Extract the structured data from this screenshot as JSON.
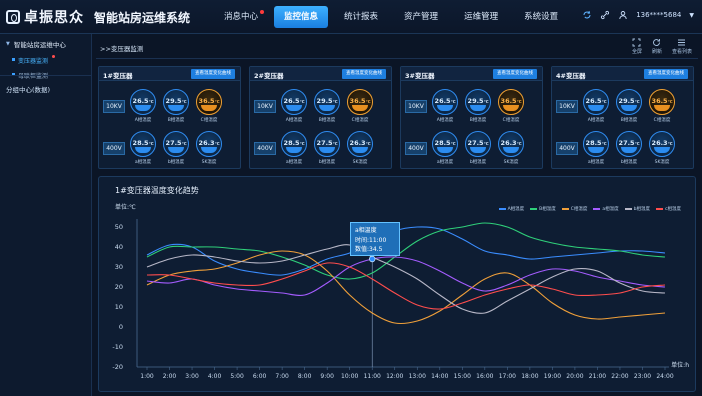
{
  "header": {
    "brand": "卓振思众",
    "app_title": "智能站房运维系统",
    "nav": [
      {
        "label": "消息中心",
        "active": false,
        "dot": true
      },
      {
        "label": "监控信息",
        "active": true,
        "dot": false
      },
      {
        "label": "统计报表",
        "active": false,
        "dot": false
      },
      {
        "label": "资产管理",
        "active": false,
        "dot": false
      },
      {
        "label": "运维管理",
        "active": false,
        "dot": false
      },
      {
        "label": "系统设置",
        "active": false,
        "dot": false
      }
    ],
    "user": "136****5684"
  },
  "sidebar": {
    "group1": "智能站房运维中心",
    "items": [
      {
        "label": "变压器监测",
        "active": true
      },
      {
        "label": "母联柜监测",
        "active": false
      }
    ],
    "group2": "分组中心(数据)"
  },
  "main": {
    "breadcrumb": ">>变压器监测",
    "tools": [
      "全屏",
      "刷新",
      "查看列表"
    ]
  },
  "cards": [
    {
      "title": "1#变压器",
      "button": "查看温度变化曲线",
      "row1": {
        "volt": "10KV",
        "gauges": [
          {
            "v": "26.5",
            "l": "A相温度"
          },
          {
            "v": "29.5",
            "l": "B相温度"
          },
          {
            "v": "36.5",
            "l": "C相温度",
            "warn": true
          }
        ]
      },
      "row2": {
        "volt": "400V",
        "gauges": [
          {
            "v": "28.5",
            "l": "a相温度"
          },
          {
            "v": "27.5",
            "l": "b相温度"
          },
          {
            "v": "26.3",
            "l": "SK温度"
          }
        ]
      }
    },
    {
      "title": "2#变压器",
      "button": "查看温度变化曲线",
      "row1": {
        "volt": "10KV",
        "gauges": [
          {
            "v": "26.5",
            "l": "A相温度"
          },
          {
            "v": "29.5",
            "l": "B相温度"
          },
          {
            "v": "36.5",
            "l": "C相温度",
            "warn": true
          }
        ]
      },
      "row2": {
        "volt": "400V",
        "gauges": [
          {
            "v": "28.5",
            "l": "a相温度"
          },
          {
            "v": "27.5",
            "l": "b相温度"
          },
          {
            "v": "26.3",
            "l": "SK温度"
          }
        ]
      }
    },
    {
      "title": "3#变压器",
      "button": "查看温度变化曲线",
      "row1": {
        "volt": "10KV",
        "gauges": [
          {
            "v": "26.5",
            "l": "A相温度"
          },
          {
            "v": "29.5",
            "l": "B相温度"
          },
          {
            "v": "36.5",
            "l": "C相温度",
            "warn": true
          }
        ]
      },
      "row2": {
        "volt": "400V",
        "gauges": [
          {
            "v": "28.5",
            "l": "a相温度"
          },
          {
            "v": "27.5",
            "l": "b相温度"
          },
          {
            "v": "26.3",
            "l": "SK温度"
          }
        ]
      }
    },
    {
      "title": "4#变压器",
      "button": "查看温度变化曲线",
      "row1": {
        "volt": "10KV",
        "gauges": [
          {
            "v": "26.5",
            "l": "A相温度"
          },
          {
            "v": "29.5",
            "l": "B相温度"
          },
          {
            "v": "36.5",
            "l": "C相温度",
            "warn": true
          }
        ]
      },
      "row2": {
        "volt": "400V",
        "gauges": [
          {
            "v": "28.5",
            "l": "a相温度"
          },
          {
            "v": "27.5",
            "l": "b相温度"
          },
          {
            "v": "26.3",
            "l": "SK温度"
          }
        ]
      }
    }
  ],
  "gauge_unit": "℃",
  "chart_data": {
    "type": "line",
    "title": "1#变压器温度变化趋势",
    "ylabel": "单位:℃",
    "xlabel": "单位:h",
    "ylim": [
      -20,
      50
    ],
    "yticks": [
      50,
      40,
      30,
      20,
      10,
      0,
      -10,
      -20
    ],
    "categories": [
      "1:00",
      "2:00",
      "3:00",
      "4:00",
      "5:00",
      "6:00",
      "7:00",
      "8:00",
      "9:00",
      "10:00",
      "11:00",
      "12:00",
      "13:00",
      "14:00",
      "15:00",
      "16:00",
      "17:00",
      "18:00",
      "19:00",
      "20:00",
      "21:00",
      "22:00",
      "23:00",
      "24:00"
    ],
    "legend_position": "top-right",
    "grid": false,
    "series": [
      {
        "name": "A相温度",
        "color": "#3a8dff",
        "values": [
          36,
          41,
          40,
          33,
          29,
          27,
          26,
          29,
          34,
          37,
          42,
          48,
          50,
          49,
          44,
          38,
          36,
          34,
          35,
          36,
          37,
          38,
          38,
          37
        ]
      },
      {
        "name": "B相温度",
        "color": "#2fd07a",
        "values": [
          35,
          40,
          40,
          40,
          39,
          38,
          35,
          31,
          26,
          24,
          27,
          35,
          43,
          48,
          50,
          52,
          50,
          45,
          42,
          40,
          39,
          38,
          36,
          35
        ]
      },
      {
        "name": "C相温度",
        "color": "#f0a03a",
        "values": [
          21,
          26,
          28,
          29,
          32,
          36,
          38,
          36,
          28,
          16,
          7,
          2,
          3,
          8,
          16,
          24,
          27,
          21,
          12,
          6,
          4,
          5,
          6,
          7
        ]
      },
      {
        "name": "a相温度",
        "color": "#a45cff",
        "values": [
          23,
          22,
          24,
          21,
          19,
          18,
          17,
          16,
          22,
          30,
          34,
          35,
          33,
          28,
          22,
          18,
          21,
          26,
          29,
          28,
          25,
          23,
          21,
          20
        ]
      },
      {
        "name": "b相温度",
        "color": "#b8b8c8",
        "values": [
          30,
          34,
          36,
          35,
          33,
          32,
          33,
          36,
          39,
          41,
          35,
          30,
          24,
          16,
          9,
          7,
          13,
          19,
          25,
          29,
          28,
          22,
          18,
          17
        ]
      },
      {
        "name": "c相温度",
        "color": "#ff4d4d",
        "values": [
          26,
          26,
          24,
          22,
          21,
          21,
          24,
          28,
          32,
          30,
          24,
          17,
          11,
          9,
          12,
          16,
          19,
          21,
          19,
          16,
          16,
          17,
          20,
          21
        ]
      }
    ],
    "tooltip": {
      "title": "a相温度",
      "time_label": "时间:11:00",
      "value_label": "数值:34.5"
    }
  }
}
